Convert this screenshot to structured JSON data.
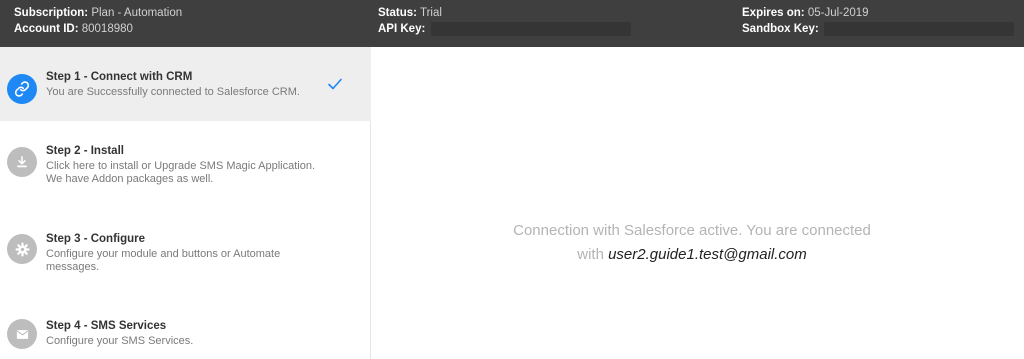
{
  "header": {
    "subscription_label": "Subscription:",
    "subscription_value": "Plan - Automation",
    "account_label": "Account ID:",
    "account_value": "80018980",
    "status_label": "Status:",
    "status_value": "Trial",
    "api_key_label": "API Key:",
    "expires_label": "Expires on:",
    "expires_value": "05-Jul-2019",
    "sandbox_label": "Sandbox Key:"
  },
  "steps": [
    {
      "title": "Step 1 - Connect with CRM",
      "description": "You are Successfully connected to Salesforce CRM.",
      "icon": "link-icon",
      "state": "completed"
    },
    {
      "title": "Step 2 - Install",
      "description": "Click here to install or Upgrade SMS Magic Application. We have Addon packages as well.",
      "icon": "download-icon",
      "state": "pending"
    },
    {
      "title": "Step 3 - Configure",
      "description": "Configure your module and buttons or Automate messages.",
      "icon": "gear-icon",
      "state": "pending"
    },
    {
      "title": "Step 4 - SMS Services",
      "description": "Configure your SMS Services.",
      "icon": "envelope-icon",
      "state": "pending"
    }
  ],
  "main": {
    "message_line1": "Connection with Salesforce active. You are connected",
    "message_with": "with",
    "email": "user2.guide1.test@gmail.com"
  },
  "colors": {
    "header_bg": "#3f3f3f",
    "accent": "#1e88f5",
    "inactive_icon": "#bdbdbd",
    "active_row_bg": "#eeeeee"
  }
}
